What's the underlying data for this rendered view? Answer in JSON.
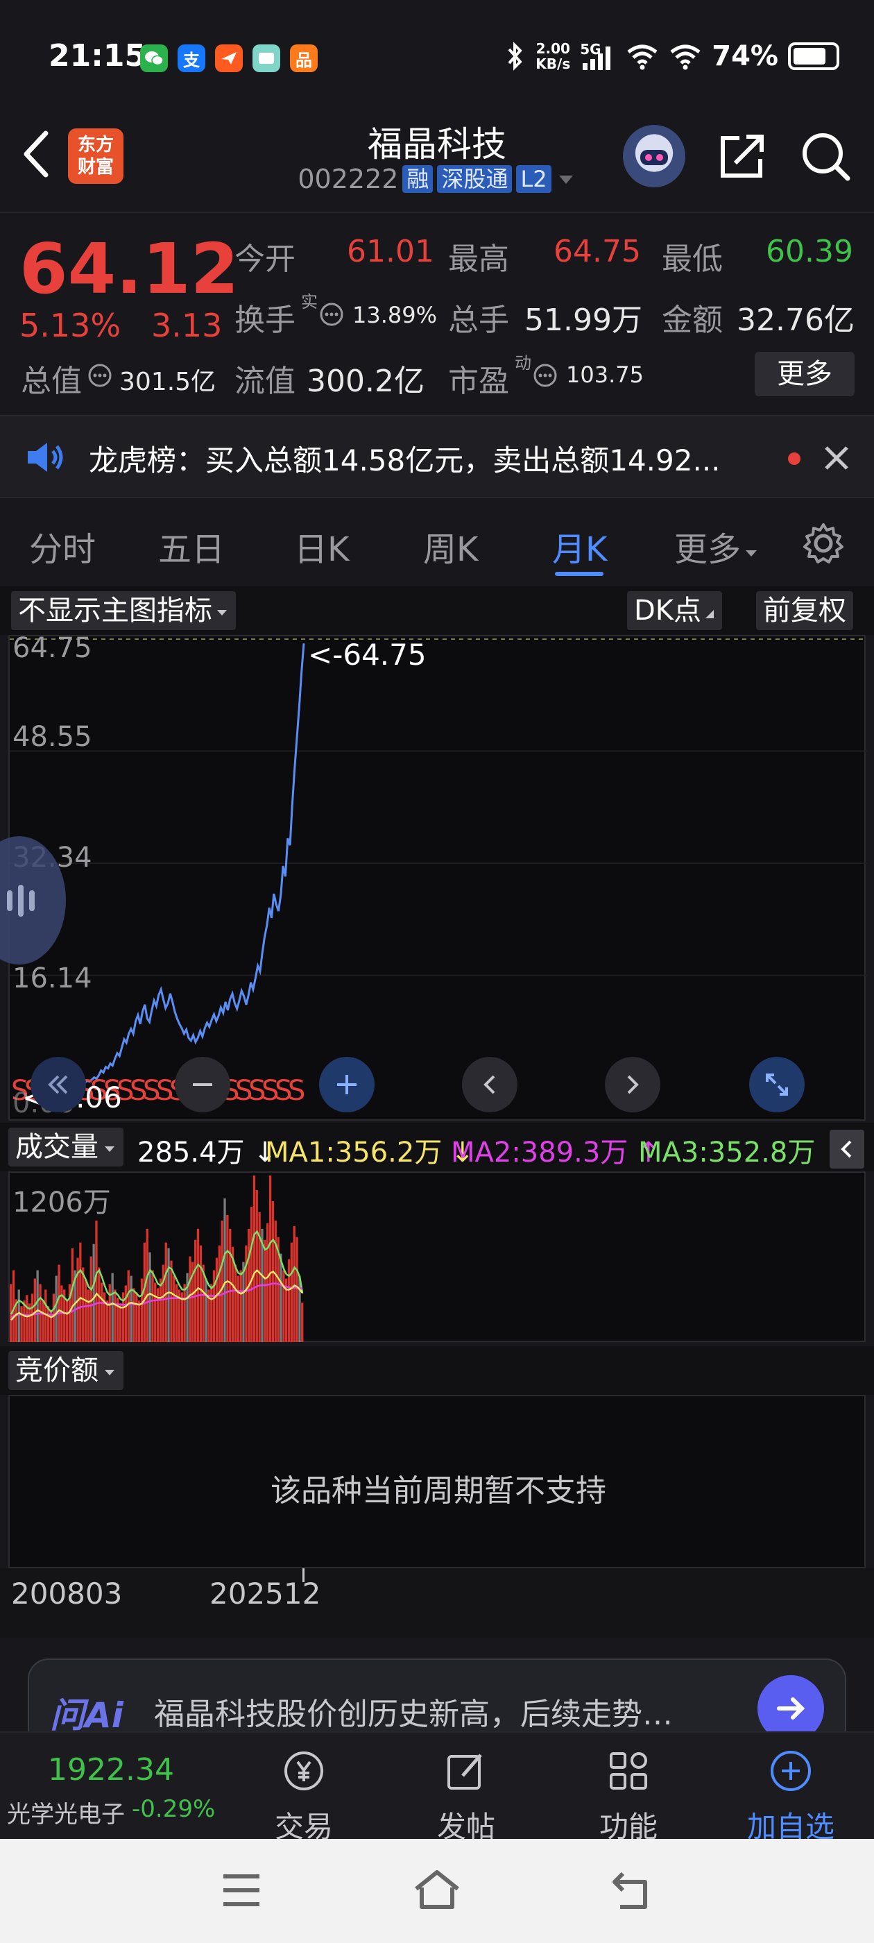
{
  "status_bar": {
    "time": "21:15",
    "net_speed_value": "2.00",
    "net_speed_unit": "KB/s",
    "network": "5G",
    "battery": "74%",
    "battery_level": 0.74,
    "apps": [
      "wechat-icon",
      "alipay-icon",
      "mail-icon",
      "gallery-icon",
      "taobao-icon"
    ],
    "alipay_label": "支",
    "taobao_label": "品"
  },
  "header": {
    "logo_line1": "东方",
    "logo_line2": "财富",
    "stock_name": "福晶科技",
    "stock_code": "002222",
    "tags": [
      "融",
      "深股通",
      "L2"
    ]
  },
  "quote": {
    "price": "64.12",
    "change_pct": "5.13%",
    "change": "3.13",
    "open_label": "今开",
    "open": "61.01",
    "high_label": "最高",
    "high": "64.75",
    "low_label": "最低",
    "low": "60.39",
    "turnover_label": "换手",
    "turnover_sup": "实",
    "turnover": "13.89%",
    "volume_label": "总手",
    "volume": "51.99万",
    "amount_label": "金额",
    "amount": "32.76亿",
    "mktcap_label": "总值",
    "mktcap": "301.5亿",
    "float_label": "流值",
    "float_cap": "300.2亿",
    "pe_label": "市盈",
    "pe_sup": "动",
    "pe": "103.75",
    "more_label": "更多"
  },
  "notice": {
    "text": "龙虎榜：买入总额14.58亿元，卖出总额14.92..."
  },
  "tabs": [
    "分时",
    "五日",
    "日K",
    "周K",
    "月K",
    "更多"
  ],
  "active_tab": "月K",
  "chart_toolbar": {
    "indicator": "不显示主图指标",
    "dk": "DK点",
    "adjust": "前复权"
  },
  "main_chart": {
    "high_marker": "<-64.75",
    "low_marker": "<-0.06",
    "y_labels": [
      "64.75",
      "48.55",
      "32.34",
      "16.14",
      "0.06"
    ]
  },
  "volume": {
    "label": "成交量",
    "current": "285.4万",
    "current_arrow": "↓",
    "ma1": "MA1:356.2万",
    "ma1_arrow": "↓",
    "ma2": "MA2:389.3万",
    "ma2_arrow": "↑",
    "ma3": "MA3:352.8万",
    "ma3_arrow": "↑",
    "max_label": "1206万",
    "ma_colors": {
      "ma1": "#f5e36a",
      "ma2": "#e040e8",
      "ma3": "#7be06a"
    }
  },
  "bid": {
    "label": "竞价额",
    "message": "该品种当前周期暂不支持"
  },
  "dates": [
    "200803",
    "202512"
  ],
  "ai": {
    "logo": "问Ai",
    "prompt": "福晶科技股价创历史新高，后续走势…"
  },
  "bottom_nav": {
    "index_value": "1922.34",
    "index_name": "光学光电子",
    "index_change": "-0.29%",
    "items": [
      "交易",
      "发帖",
      "功能",
      "加自选"
    ]
  },
  "chart_data": {
    "type": "line",
    "title": "",
    "x_range": [
      "200803",
      "202512"
    ],
    "ylim": [
      0.06,
      64.75
    ],
    "series": [
      {
        "values": [
          0.8,
          0.6,
          0.4,
          0.3,
          0.2,
          0.25,
          0.3,
          0.35,
          0.3,
          0.35,
          0.5,
          0.4,
          0.6,
          0.7,
          0.8,
          1.0,
          0.9,
          1.2,
          1.5,
          1.3,
          1.8,
          2.5,
          2.2,
          3.0,
          2.8,
          3.5,
          3.2,
          4.2,
          5.0,
          4.6,
          5.8,
          7.0,
          6.5,
          7.8,
          8.5,
          7.8,
          9.6,
          10.5,
          9.2,
          11.0,
          12.0,
          10.0,
          9.5,
          11.2,
          12.6,
          11.8,
          13.4,
          14.2,
          12.8,
          11.5,
          12.2,
          13.6,
          12.4,
          11.0,
          10.0,
          9.2,
          8.6,
          7.8,
          8.4,
          7.2,
          6.8,
          7.6,
          6.6,
          7.2,
          8.2,
          7.4,
          8.6,
          9.4,
          8.8,
          9.8,
          10.6,
          9.6,
          10.4,
          11.6,
          10.8,
          12.4,
          11.2,
          12.8,
          13.6,
          12.2,
          11.4,
          12.6,
          14.0,
          13.2,
          12.0,
          13.4,
          15.2,
          14.2,
          15.8,
          17.6,
          16.8,
          19.5,
          21.8,
          23.5,
          26.0,
          24.5,
          28.0,
          26.5,
          25.5,
          27.8,
          32.0,
          30.5,
          36.0,
          35.0,
          41.0,
          46.0,
          50.5,
          55.0,
          60.0,
          64.12
        ]
      }
    ]
  },
  "volume_data": {
    "type": "bar",
    "max": 1206,
    "unit": "万",
    "values": [
      420,
      520,
      310,
      380,
      260,
      300,
      340,
      280,
      350,
      460,
      520,
      420,
      300,
      380,
      260,
      220,
      350,
      480,
      560,
      410,
      380,
      300,
      420,
      680,
      520,
      610,
      720,
      540,
      450,
      380,
      620,
      710,
      880,
      540,
      430,
      360,
      300,
      420,
      500,
      380,
      320,
      280,
      360,
      410,
      520,
      480,
      390,
      360,
      300,
      460,
      720,
      820,
      650,
      520,
      430,
      390,
      460,
      560,
      720,
      680,
      590,
      480,
      420,
      380,
      360,
      420,
      500,
      620,
      580,
      740,
      820,
      700,
      560,
      460,
      380,
      420,
      520,
      610,
      700,
      880,
      1040,
      920,
      820,
      690,
      560,
      480,
      520,
      580,
      700,
      820,
      980,
      1206,
      1100,
      940,
      820,
      740,
      860,
      1206,
      1020,
      880,
      760,
      640,
      520,
      460,
      600,
      720,
      840,
      760,
      480,
      285
    ],
    "ma1": [
      160,
      180,
      200,
      210,
      200,
      190,
      185,
      190,
      200,
      215,
      230,
      220,
      210,
      200,
      190,
      180,
      190,
      210,
      230,
      220,
      210,
      205,
      220,
      260,
      280,
      300,
      320,
      310,
      300,
      290,
      300,
      320,
      350,
      330,
      310,
      290,
      270,
      270,
      280,
      270,
      260,
      250,
      250,
      260,
      280,
      285,
      280,
      275,
      270,
      280,
      310,
      340,
      350,
      340,
      330,
      320,
      320,
      330,
      350,
      360,
      355,
      340,
      330,
      320,
      310,
      310,
      320,
      340,
      350,
      370,
      390,
      380,
      360,
      340,
      320,
      310,
      320,
      340,
      360,
      390,
      430,
      440,
      430,
      410,
      380,
      360,
      350,
      360,
      380,
      410,
      450,
      500,
      520,
      500,
      480,
      460,
      470,
      500,
      510,
      490,
      460,
      430,
      400,
      380,
      380,
      390,
      410,
      400,
      380,
      356
    ],
    "ma2": [
      180,
      190,
      195,
      200,
      200,
      198,
      196,
      196,
      198,
      202,
      206,
      206,
      204,
      202,
      200,
      198,
      198,
      202,
      208,
      210,
      210,
      210,
      214,
      224,
      234,
      244,
      254,
      258,
      260,
      262,
      266,
      272,
      280,
      284,
      284,
      282,
      280,
      278,
      278,
      276,
      274,
      272,
      270,
      270,
      272,
      274,
      274,
      274,
      274,
      276,
      282,
      290,
      296,
      300,
      302,
      304,
      306,
      308,
      312,
      316,
      318,
      318,
      318,
      318,
      316,
      316,
      318,
      322,
      326,
      332,
      338,
      340,
      340,
      338,
      336,
      334,
      334,
      336,
      340,
      346,
      356,
      364,
      370,
      372,
      372,
      370,
      368,
      368,
      370,
      374,
      382,
      394,
      404,
      410,
      412,
      412,
      414,
      420,
      424,
      424,
      420,
      414,
      406,
      400,
      396,
      394,
      394,
      392,
      390,
      389
    ],
    "ma3": [
      200,
      240,
      280,
      300,
      290,
      270,
      250,
      240,
      250,
      270,
      300,
      320,
      300,
      270,
      240,
      220,
      240,
      280,
      330,
      340,
      320,
      300,
      320,
      400,
      460,
      500,
      520,
      490,
      450,
      400,
      380,
      420,
      500,
      520,
      470,
      410,
      360,
      340,
      350,
      360,
      340,
      310,
      300,
      320,
      360,
      380,
      370,
      350,
      330,
      340,
      400,
      480,
      520,
      500,
      460,
      420,
      410,
      440,
      500,
      540,
      530,
      490,
      450,
      410,
      380,
      380,
      400,
      450,
      490,
      530,
      560,
      540,
      500,
      450,
      410,
      390,
      410,
      460,
      510,
      570,
      640,
      660,
      640,
      600,
      540,
      500,
      490,
      510,
      560,
      620,
      700,
      780,
      800,
      760,
      710,
      670,
      680,
      720,
      740,
      710,
      650,
      590,
      530,
      490,
      480,
      500,
      540,
      520,
      470,
      352.8
    ]
  }
}
